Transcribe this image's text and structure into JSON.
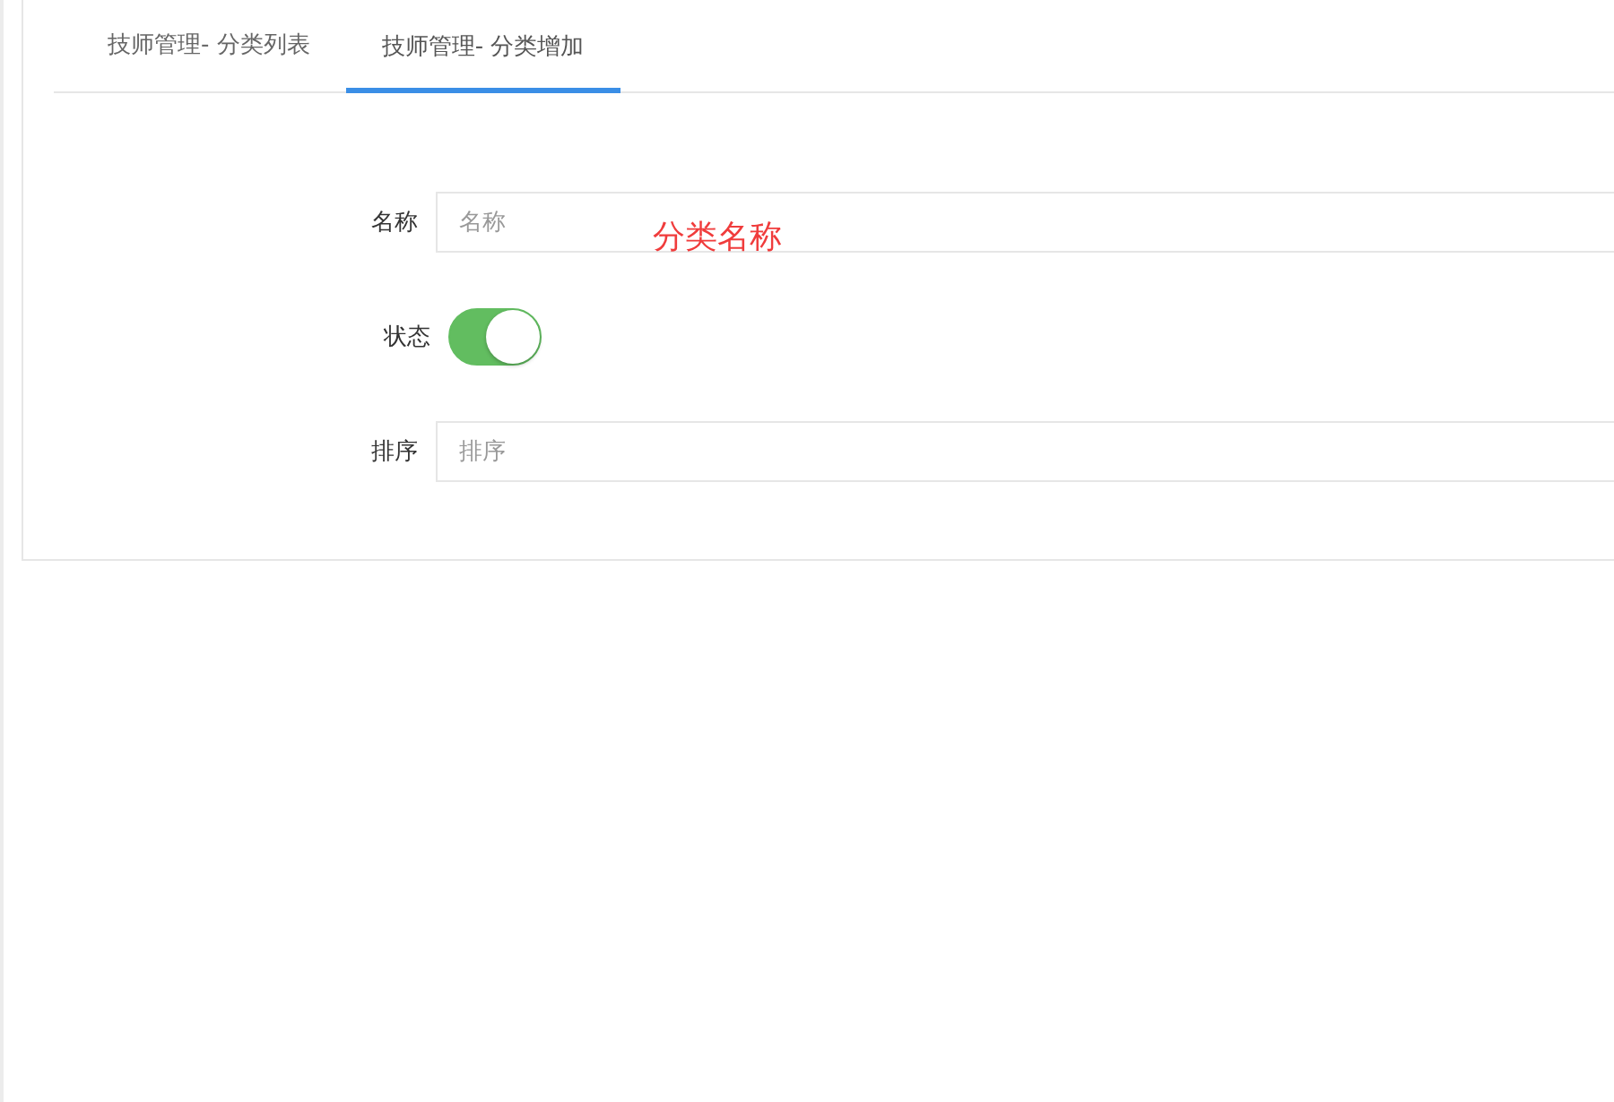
{
  "tabs": [
    {
      "label": "技师管理- 分类列表",
      "selected": false
    },
    {
      "label": "技师管理- 分类增加",
      "selected": true
    }
  ],
  "form": {
    "fields": [
      {
        "kind": "input",
        "label": "名称",
        "placeholder": "名称"
      },
      {
        "kind": "switch",
        "label": "状态",
        "on": true
      },
      {
        "kind": "input",
        "label": "排序",
        "placeholder": "排序"
      }
    ]
  },
  "annotation": "分类名称"
}
